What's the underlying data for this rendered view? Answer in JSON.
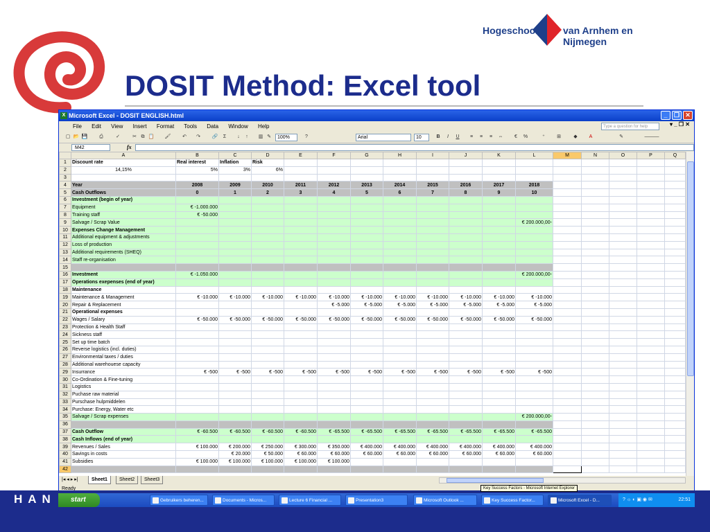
{
  "slide": {
    "title": "DOSIT Method: Excel tool",
    "logo_left": "Hogeschool",
    "logo_right": "van Arnhem en Nijmegen",
    "bottom_logo": "HAN"
  },
  "colors": {
    "slide_blue": "#1c2c8c",
    "green_fill": "#ccffcc",
    "grey_fill": "#c0c0c0",
    "negative_red": "#ff0000"
  },
  "excel": {
    "window_title": "Microsoft Excel - DOSIT ENGLISH.html",
    "menus": [
      "File",
      "Edit",
      "View",
      "Insert",
      "Format",
      "Tools",
      "Data",
      "Window",
      "Help"
    ],
    "help_placeholder": "Type a question for help",
    "zoom": "100%",
    "font_name": "Arial",
    "font_size": "10",
    "name_box": "M42",
    "fx": "fx",
    "status": "Ready",
    "sheet_tabs": [
      "Sheet1",
      "Sheet2",
      "Sheet3"
    ],
    "columns": [
      "A",
      "B",
      "C",
      "D",
      "E",
      "F",
      "G",
      "H",
      "I",
      "J",
      "K",
      "L",
      "M",
      "N",
      "O",
      "P",
      "Q"
    ],
    "rows": [
      {
        "n": "1",
        "a": "Discount rate",
        "v": [
          "Real interest",
          "Inflation",
          "Risk"
        ],
        "t": "hdr"
      },
      {
        "n": "2",
        "a": "14,15%",
        "v": [
          "5%",
          "3%",
          "6%"
        ],
        "t": "pct"
      },
      {
        "n": "3",
        "a": "",
        "v": [],
        "t": "blank"
      },
      {
        "n": "4",
        "a": "Year",
        "v": [
          "2008",
          "2009",
          "2010",
          "2011",
          "2012",
          "2013",
          "2014",
          "2015",
          "2016",
          "2017",
          "2018"
        ],
        "t": "grey"
      },
      {
        "n": "5",
        "a": "Cash Outflows",
        "v": [
          "0",
          "1",
          "2",
          "3",
          "4",
          "5",
          "6",
          "7",
          "8",
          "9",
          "10"
        ],
        "t": "grey"
      },
      {
        "n": "6",
        "a": "Investment (begin of year)",
        "v": [],
        "t": "gsec"
      },
      {
        "n": "7",
        "a": "Equipment",
        "v": [
          "€ -1.000.000"
        ],
        "t": "g"
      },
      {
        "n": "8",
        "a": "Training staff",
        "v": [
          "€ -50.000"
        ],
        "t": "g"
      },
      {
        "n": "9",
        "a": "Salvage / Scrap Value",
        "v": [
          "",
          "",
          "",
          "",
          "",
          "",
          "",
          "",
          "",
          "",
          "€ 200.000,00-"
        ],
        "t": "g"
      },
      {
        "n": "10",
        "a": "Expenses Change Management",
        "v": [],
        "t": "gsec"
      },
      {
        "n": "11",
        "a": "Additional equipment & adjustments",
        "v": [],
        "t": "g"
      },
      {
        "n": "12",
        "a": "Loss of production",
        "v": [],
        "t": "g"
      },
      {
        "n": "13",
        "a": "Additional requirements (SHEQ)",
        "v": [],
        "t": "g"
      },
      {
        "n": "14",
        "a": "Staff re-organisation",
        "v": [],
        "t": "g"
      },
      {
        "n": "15",
        "a": "",
        "v": [],
        "t": "greyrow"
      },
      {
        "n": "16",
        "a": "Investment",
        "v": [
          "€ -1.050.000",
          "",
          "",
          "",
          "",
          "",
          "",
          "",
          "",
          "",
          "€ 200.000,00-"
        ],
        "t": "gtot"
      },
      {
        "n": "17",
        "a": "Operations exepenses (end of year)",
        "v": [],
        "t": "gsec"
      },
      {
        "n": "18",
        "a": "Maintenance",
        "v": [],
        "t": "bold"
      },
      {
        "n": "19",
        "a": "Maintenance & Management",
        "v": [
          "€ -10.000",
          "€ -10.000",
          "€ -10.000",
          "€ -10.000",
          "€ -10.000",
          "€ -10.000",
          "€ -10.000",
          "€ -10.000",
          "€ -10.000",
          "€ -10.000",
          "€ -10.000"
        ],
        "t": "plain"
      },
      {
        "n": "20",
        "a": "Repair & Replacement",
        "v": [
          "",
          "",
          "",
          "",
          "€ -5.000",
          "€ -5.000",
          "€ -5.000",
          "€ -5.000",
          "€ -5.000",
          "€ -5.000",
          "€ -5.000"
        ],
        "t": "plain"
      },
      {
        "n": "21",
        "a": "Operational expenses",
        "v": [],
        "t": "bold"
      },
      {
        "n": "22",
        "a": "Wages / Salary",
        "v": [
          "€ -50.000",
          "€ -50.000",
          "€ -50.000",
          "€ -50.000",
          "€ -50.000",
          "€ -50.000",
          "€ -50.000",
          "€ -50.000",
          "€ -50.000",
          "€ -50.000",
          "€ -50.000"
        ],
        "t": "plain"
      },
      {
        "n": "23",
        "a": "Protection & Health Staff",
        "v": [],
        "t": "plain"
      },
      {
        "n": "24",
        "a": "Sickness staff",
        "v": [],
        "t": "plain"
      },
      {
        "n": "25",
        "a": "Set up time batch",
        "v": [],
        "t": "plain"
      },
      {
        "n": "26",
        "a": "Reverse logistics (incl. duties)",
        "v": [],
        "t": "plain"
      },
      {
        "n": "27",
        "a": "Environmental taxes / duties",
        "v": [],
        "t": "plain"
      },
      {
        "n": "28",
        "a": "Additional warehouese capacity",
        "v": [],
        "t": "plain"
      },
      {
        "n": "29",
        "a": "Insurrance",
        "v": [
          "€ -500",
          "€ -500",
          "€ -500",
          "€ -500",
          "€ -500",
          "€ -500",
          "€ -500",
          "€ -500",
          "€ -500",
          "€ -500",
          "€ -500"
        ],
        "t": "plain"
      },
      {
        "n": "30",
        "a": "Co-Ordination & Fine-tuning",
        "v": [],
        "t": "plain"
      },
      {
        "n": "31",
        "a": "Logistics",
        "v": [],
        "t": "plain"
      },
      {
        "n": "32",
        "a": "Puchase raw material",
        "v": [],
        "t": "plain"
      },
      {
        "n": "33",
        "a": "Purschase hulpmiddelen",
        "v": [],
        "t": "plain"
      },
      {
        "n": "34",
        "a": "Purchase:  Energy, Water etc",
        "v": [],
        "t": "plain"
      },
      {
        "n": "35",
        "a": "Salvage / Scrap expenses",
        "v": [
          "",
          "",
          "",
          "",
          "",
          "",
          "",
          "",
          "",
          "",
          "€ 200.000,00-"
        ],
        "t": "g"
      },
      {
        "n": "36",
        "a": "",
        "v": [],
        "t": "greyrow"
      },
      {
        "n": "37",
        "a": "Cash Outflow",
        "v": [
          "€ -60.500",
          "€ -60.500",
          "€ -60.500",
          "€ -60.500",
          "€ -65.500",
          "€ -65.500",
          "€ -65.500",
          "€ -65.500",
          "€ -65.500",
          "€ -65.500",
          "€ -65.500"
        ],
        "t": "gtot"
      },
      {
        "n": "38",
        "a": "Cash Inflows (end of year)",
        "v": [],
        "t": "gsec"
      },
      {
        "n": "39",
        "a": "Revenues / Sales",
        "v": [
          "€ 100.000",
          "€ 200.000",
          "€ 250.000",
          "€ 300.000",
          "€ 350.000",
          "€ 400.000",
          "€ 400.000",
          "€ 400.000",
          "€ 400.000",
          "€ 400.000",
          "€ 400.000"
        ],
        "t": "pos"
      },
      {
        "n": "40",
        "a": "Savings in costs",
        "v": [
          "",
          "€ 20.000",
          "€ 50.000",
          "€ 60.000",
          "€ 60.000",
          "€ 60.000",
          "€ 60.000",
          "€ 60.000",
          "€ 60.000",
          "€ 60.000",
          "€ 60.000"
        ],
        "t": "pos"
      },
      {
        "n": "41",
        "a": "Subsidies",
        "v": [
          "€ 100.000",
          "€ 100.000",
          "€ 100.000",
          "€ 100.000",
          "€ 100.000"
        ],
        "t": "pos"
      },
      {
        "n": "42",
        "a": "",
        "v": [],
        "t": "greyrow"
      }
    ]
  },
  "taskbar": {
    "start": "start",
    "tasks": [
      "Gebruikers beheren...",
      "Documents - Micros...",
      "Lecture 6 Financial ...",
      "Presentation3",
      "Microsoft Outlook ...",
      "Key Success Factor...",
      "Microsoft Excel - D..."
    ],
    "clock": "22:51",
    "tooltip": "Key Success Factors - Microsoft Internet Explorer"
  }
}
